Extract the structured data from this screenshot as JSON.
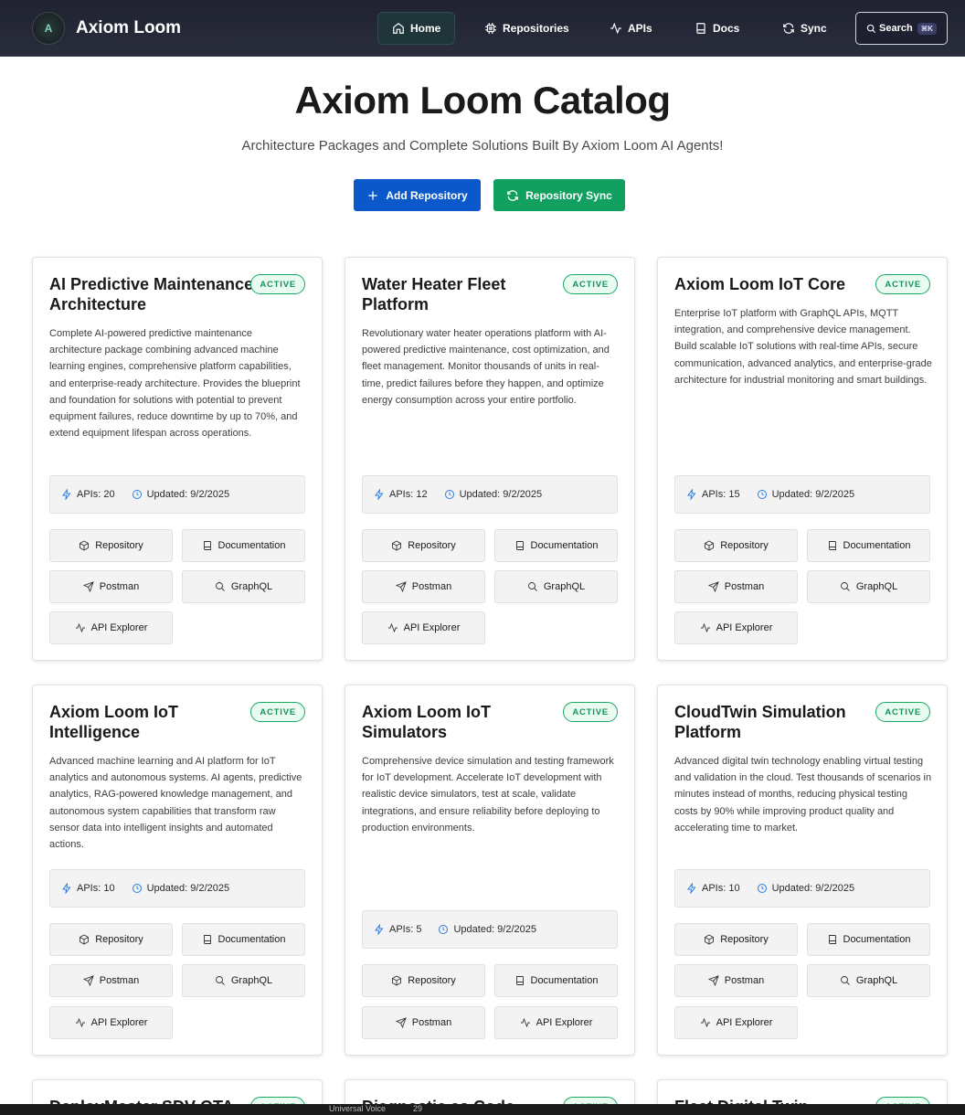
{
  "nav": {
    "brand": "Axiom Loom",
    "logo_letter": "A",
    "items": [
      {
        "label": "Home",
        "icon": "home-icon"
      },
      {
        "label": "Repositories",
        "icon": "cpu-icon"
      },
      {
        "label": "APIs",
        "icon": "activity-icon"
      },
      {
        "label": "Docs",
        "icon": "book-icon"
      },
      {
        "label": "Sync",
        "icon": "refresh-icon"
      }
    ],
    "search_label": "Search",
    "search_shortcut": "⌘K"
  },
  "hero": {
    "title": "Axiom Loom Catalog",
    "subtitle": "Architecture Packages and Complete Solutions Built By Axiom Loom AI Agents!",
    "add_label": "Add Repository",
    "sync_label": "Repository Sync"
  },
  "colors": {
    "nav_bg": "#22252f",
    "primary": "#0a58ca",
    "success": "#11a05f",
    "badge_green": "#17a864",
    "stat_icon": "#2a7be0"
  },
  "cards": [
    {
      "title": "AI Predictive Maintenance Architecture",
      "status": "ACTIVE",
      "description": "Complete AI-powered predictive maintenance architecture package combining advanced machine learning engines, comprehensive platform capabilities, and enterprise-ready architecture. Provides the blueprint and foundation for solutions with potential to prevent equipment failures, reduce downtime by up to 70%, and extend equipment lifespan across operations.",
      "apis": "APIs: 20",
      "updated": "Updated: 9/2/2025",
      "actions": [
        "Repository",
        "Documentation",
        "Postman",
        "GraphQL",
        "API Explorer"
      ]
    },
    {
      "title": "Water Heater Fleet Platform",
      "status": "ACTIVE",
      "description": "Revolutionary water heater operations platform with AI-powered predictive maintenance, cost optimization, and fleet management. Monitor thousands of units in real-time, predict failures before they happen, and optimize energy consumption across your entire portfolio.",
      "apis": "APIs: 12",
      "updated": "Updated: 9/2/2025",
      "actions": [
        "Repository",
        "Documentation",
        "Postman",
        "GraphQL",
        "API Explorer"
      ]
    },
    {
      "title": "Axiom Loom IoT Core",
      "status": "ACTIVE",
      "description": "Enterprise IoT platform with GraphQL APIs, MQTT integration, and comprehensive device management. Build scalable IoT solutions with real-time APIs, secure communication, advanced analytics, and enterprise-grade architecture for industrial monitoring and smart buildings.",
      "apis": "APIs: 15",
      "updated": "Updated: 9/2/2025",
      "actions": [
        "Repository",
        "Documentation",
        "Postman",
        "GraphQL",
        "API Explorer"
      ]
    },
    {
      "title": "Axiom Loom IoT Intelligence",
      "status": "ACTIVE",
      "description": "Advanced machine learning and AI platform for IoT analytics and autonomous systems. AI agents, predictive analytics, RAG-powered knowledge management, and autonomous system capabilities that transform raw sensor data into intelligent insights and automated actions.",
      "apis": "APIs: 10",
      "updated": "Updated: 9/2/2025",
      "actions": [
        "Repository",
        "Documentation",
        "Postman",
        "GraphQL",
        "API Explorer"
      ]
    },
    {
      "title": "Axiom Loom IoT Simulators",
      "status": "ACTIVE",
      "description": "Comprehensive device simulation and testing framework for IoT development. Accelerate IoT development with realistic device simulators, test at scale, validate integrations, and ensure reliability before deploying to production environments.",
      "apis": "APIs: 5",
      "updated": "Updated: 9/2/2025",
      "actions": [
        "Repository",
        "Documentation",
        "Postman",
        "API Explorer"
      ]
    },
    {
      "title": "CloudTwin Simulation Platform",
      "status": "ACTIVE",
      "description": "Advanced digital twin technology enabling virtual testing and validation in the cloud. Test thousands of scenarios in minutes instead of months, reducing physical testing costs by 90% while improving product quality and accelerating time to market.",
      "apis": "APIs: 10",
      "updated": "Updated: 9/2/2025",
      "actions": [
        "Repository",
        "Documentation",
        "Postman",
        "GraphQL",
        "API Explorer"
      ]
    }
  ],
  "partial_cards": [
    {
      "title": "DeployMaster SDV OTA",
      "status": "ACTIVE"
    },
    {
      "title": "Diagnostic as Code",
      "status": "ACTIVE"
    },
    {
      "title": "Fleet Digital Twin",
      "status": "ACTIVE"
    }
  ],
  "bottom_bar": {
    "label": "Universal Voice",
    "number": "29"
  }
}
